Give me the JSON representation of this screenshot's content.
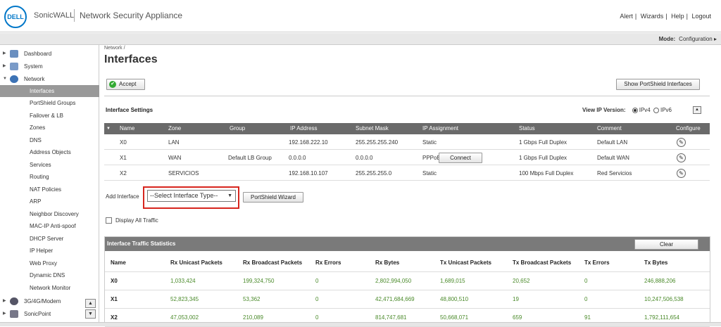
{
  "header": {
    "logo_text": "DELL",
    "brand": "SonicWALL",
    "product": "Network Security Appliance",
    "links": [
      "Alert",
      "Wizards",
      "Help",
      "Logout"
    ]
  },
  "modebar": {
    "mode_label": "Mode:",
    "mode_value": "Configuration ▸"
  },
  "sidebar": {
    "top_items": [
      {
        "label": "Dashboard",
        "arrow": "▶"
      },
      {
        "label": "System",
        "arrow": "▶"
      },
      {
        "label": "Network",
        "arrow": "▼"
      }
    ],
    "network_items": [
      "Interfaces",
      "PortShield Groups",
      "Failover & LB",
      "Zones",
      "DNS",
      "Address Objects",
      "Services",
      "Routing",
      "NAT Policies",
      "ARP",
      "Neighbor Discovery",
      "MAC-IP Anti-spoof",
      "DHCP Server",
      "IP Helper",
      "Web Proxy",
      "Dynamic DNS",
      "Network Monitor"
    ],
    "bottom_items": [
      {
        "label": "3G/4G/Modem",
        "arrow": "▶"
      },
      {
        "label": "SonicPoint",
        "arrow": "▶"
      }
    ],
    "scroll_up": "▲",
    "scroll_down": "▼"
  },
  "main": {
    "breadcrumb": "Network /",
    "title": "Interfaces",
    "accept_label": "Accept",
    "show_portshield_label": "Show PortShield Interfaces",
    "interface_settings_title": "Interface Settings",
    "view_ip_label": "View IP Version:",
    "ipv4_label": "IPv4",
    "ipv6_label": "IPv6",
    "collapse_symbol": "▲",
    "table": {
      "headers": [
        "Name",
        "Zone",
        "Group",
        "IP Address",
        "Subnet Mask",
        "IP Assignment",
        "Status",
        "Comment",
        "Configure"
      ],
      "rows": [
        {
          "name": "X0",
          "zone": "LAN",
          "group": "",
          "ip": "192.168.222.10",
          "mask": "255.255.255.240",
          "assign": "Static",
          "status": "1 Gbps Full Duplex",
          "comment": "Default LAN"
        },
        {
          "name": "X1",
          "zone": "WAN",
          "group": "Default LB Group",
          "ip": "0.0.0.0",
          "mask": "0.0.0.0",
          "assign": "PPPoE",
          "status": "1 Gbps Full Duplex",
          "comment": "Default WAN"
        },
        {
          "name": "X2",
          "zone": "SERVICIOS",
          "group": "",
          "ip": "192.168.10.107",
          "mask": "255.255.255.0",
          "assign": "Static",
          "status": "100 Mbps Full Duplex",
          "comment": "Red Servicios"
        }
      ],
      "connect_label": "Connect"
    },
    "add_interface_label": "Add Interface",
    "select_interface_value": "--Select Interface Type--",
    "portshield_wizard_label": "PortShield Wizard",
    "display_all_label": "Display All Traffic",
    "stats": {
      "title": "Interface Traffic Statistics",
      "clear_label": "Clear",
      "headers": [
        "Name",
        "Rx Unicast Packets",
        "Rx Broadcast Packets",
        "Rx Errors",
        "Rx Bytes",
        "Tx Unicast Packets",
        "Tx Broadcast Packets",
        "Tx Errors",
        "Tx Bytes"
      ],
      "rows": [
        {
          "name": "X0",
          "rxu": "1,033,424",
          "rxb": "199,324,750",
          "rxe": "0",
          "rxbytes": "2,802,994,050",
          "txu": "1,689,015",
          "txb": "20,652",
          "txe": "0",
          "txbytes": "246,888,206"
        },
        {
          "name": "X1",
          "rxu": "52,823,345",
          "rxb": "53,362",
          "rxe": "0",
          "rxbytes": "42,471,684,669",
          "txu": "48,800,510",
          "txb": "19",
          "txe": "0",
          "txbytes": "10,247,506,538"
        },
        {
          "name": "X2",
          "rxu": "47,053,002",
          "rxb": "210,089",
          "rxe": "0",
          "rxbytes": "814,747,681",
          "txu": "50,668,071",
          "txb": "659",
          "txe": "91",
          "txbytes": "1,792,111,654"
        }
      ]
    }
  },
  "colors": {
    "accent_blue": "#0077c8",
    "highlight_red": "#d7261e",
    "stat_green": "#4a8a2a",
    "active_nav": "#999999"
  },
  "icons": [
    "dell-logo-icon",
    "dashboard-icon",
    "system-icon",
    "network-icon",
    "accept-check-icon",
    "edit-icon",
    "modem-icon",
    "sonicpoint-icon"
  ]
}
